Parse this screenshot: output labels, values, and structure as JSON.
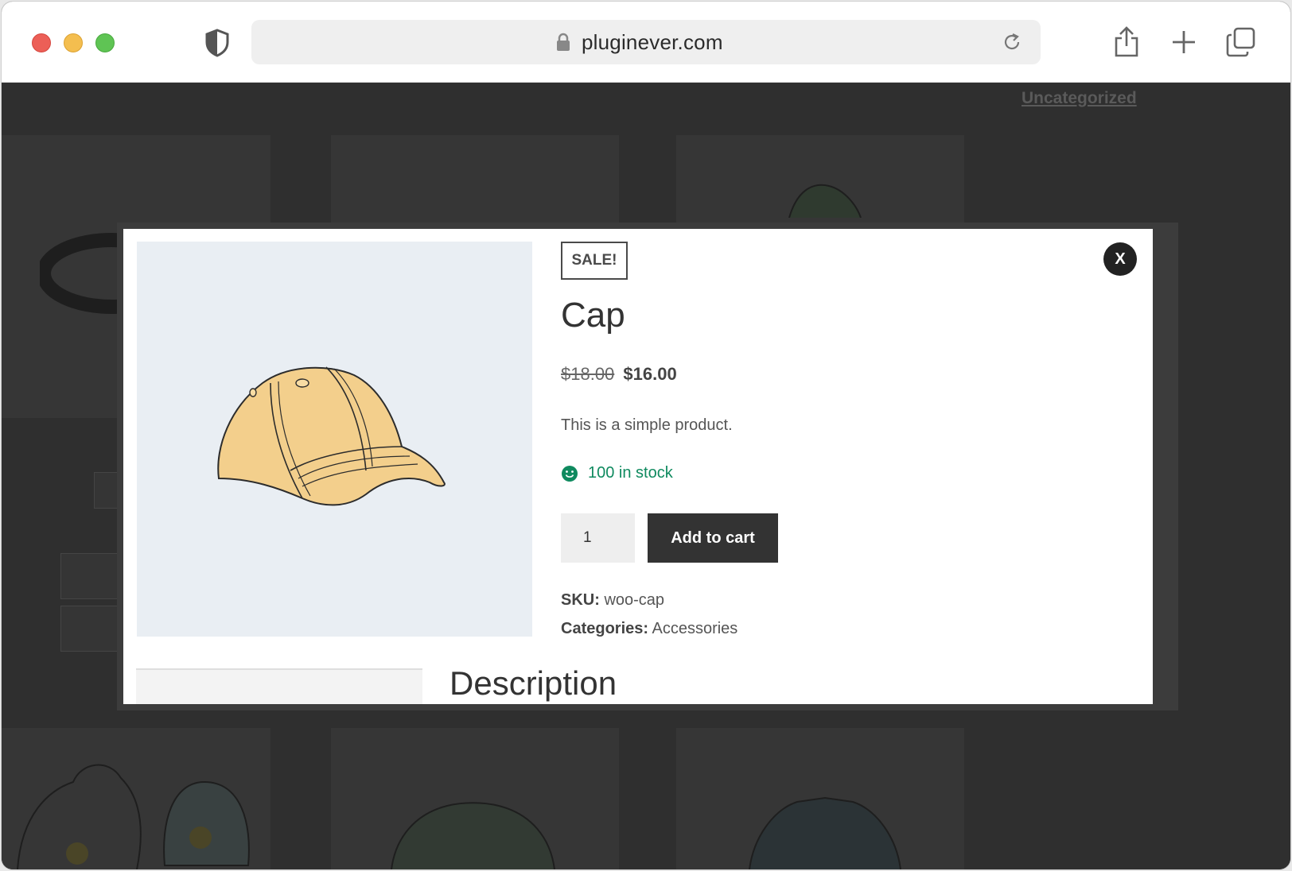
{
  "browser": {
    "url": "pluginever.com",
    "buttons": {
      "share": "share-icon",
      "new_tab": "plus-icon",
      "tabs": "tabs-overview-icon"
    }
  },
  "background_page": {
    "category_link": "Uncategorized"
  },
  "modal": {
    "close_label": "X",
    "sale_badge": "SALE!",
    "product_title": "Cap",
    "price_old": "$18.00",
    "price_new": "$16.00",
    "short_description": "This is a simple product.",
    "stock_text": "100 in stock",
    "quantity": "1",
    "add_to_cart_label": "Add to cart",
    "sku_label": "SKU:",
    "sku_value": "woo-cap",
    "categories_label": "Categories:",
    "categories_value": "Accessories",
    "description_heading": "Description"
  },
  "colors": {
    "stock": "#0f8a5f",
    "button": "#333333",
    "image_bg": "#e9eef3"
  }
}
